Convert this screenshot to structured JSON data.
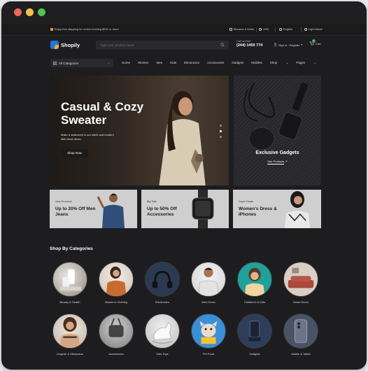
{
  "topbar": {
    "promo": "Enjoy free shipping for orders leveling $200 or more",
    "become_seller": "Become A Seller",
    "currency": "USD",
    "language": "English",
    "theme": "Light Mode"
  },
  "header": {
    "logo": "Shopily",
    "search_placeholder": "Type your product name",
    "call_label": "Call us Free",
    "call_number": "(244) 1450 774",
    "account": "Sign in / Register",
    "cart_label": "Cart",
    "cart_count": "1"
  },
  "nav": {
    "all_categories": "All Categories",
    "items": [
      "Home",
      "Women",
      "Men",
      "Kids",
      "Electronics",
      "Accessories",
      "Gadgets",
      "Mobiles",
      "Shop",
      "Pages"
    ]
  },
  "hero": {
    "title": "Casual & Cozy Sweater",
    "subtitle": "Make a statement in our sleek and modern little black dress.",
    "button": "Shop Now"
  },
  "side_promo": {
    "title": "Exclusive Gadgets",
    "link": "See Products"
  },
  "banners": [
    {
      "small": "New Products",
      "big": "Up to 20% Off Men Jeans"
    },
    {
      "small": "Big Sale",
      "big": "Up to 50% Off Accessories"
    },
    {
      "small": "Super Deals",
      "big": "Women's Dress & iPhones"
    }
  ],
  "categories_title": "Shop By Categories",
  "categories": [
    "Beauty & Health",
    "Women's Clothing",
    "Electronics",
    "Men Dress",
    "Children's & Kids",
    "Home Decor",
    "Lingerie & Sleepwear",
    "Accessories",
    "Kids Toys",
    "Pet Food",
    "Gadgets",
    "Mobile & Tablet"
  ],
  "colors": {
    "background": "#1d1d1f",
    "accent_green": "#2ea35a",
    "logo_blue": "#1f74e0",
    "logo_yellow": "#f2b124"
  }
}
